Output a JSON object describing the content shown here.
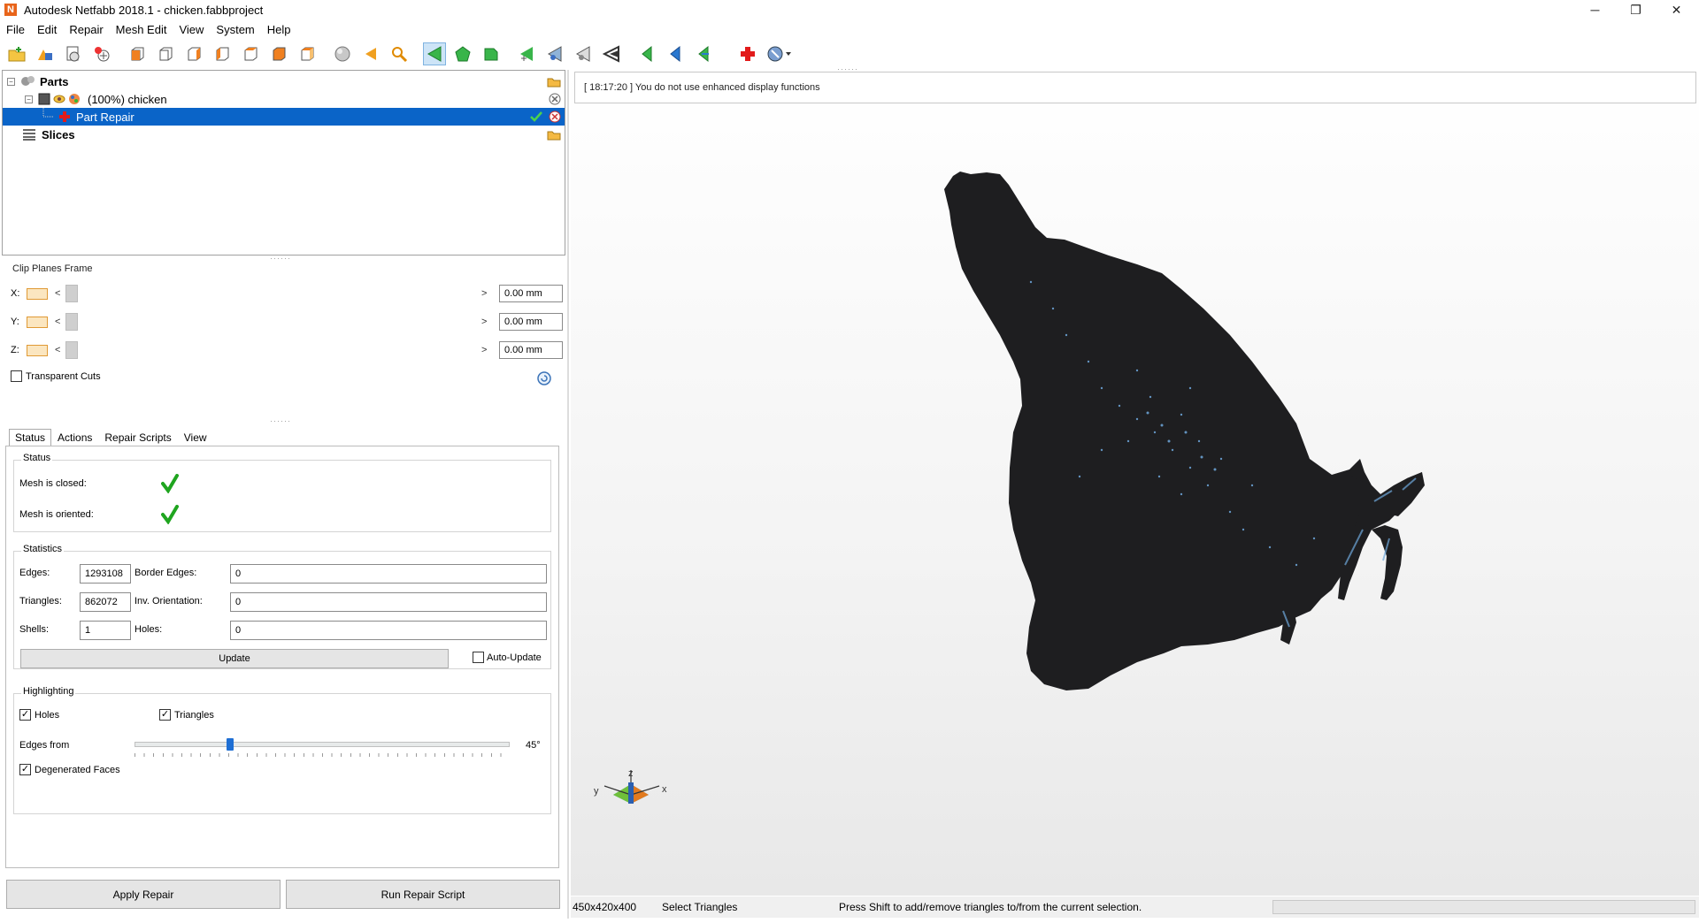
{
  "window": {
    "title": "Autodesk Netfabb 2018.1 - chicken.fabbproject",
    "app_letter": "N",
    "minimize": "─",
    "maximize": "❐",
    "close": "✕"
  },
  "menu": [
    "File",
    "Edit",
    "Repair",
    "Mesh Edit",
    "View",
    "System",
    "Help"
  ],
  "tree": {
    "parts_label": "Parts",
    "part_label": "(100%) chicken",
    "repair_label": "Part Repair",
    "slices_label": "Slices"
  },
  "clip": {
    "title": "Clip Planes Frame",
    "x_label": "X:",
    "y_label": "Y:",
    "z_label": "Z:",
    "x_value": "0.00 mm",
    "y_value": "0.00 mm",
    "z_value": "0.00 mm",
    "left_arrow": "<",
    "right_arrow": ">",
    "transparent_cuts": "Transparent Cuts"
  },
  "tabs": [
    "Status",
    "Actions",
    "Repair Scripts",
    "View"
  ],
  "status": {
    "title": "Status",
    "mesh_closed": "Mesh is closed:",
    "mesh_oriented": "Mesh is oriented:"
  },
  "statistics": {
    "title": "Statistics",
    "edges_label": "Edges:",
    "edges_value": "1293108",
    "border_edges_label": "Border Edges:",
    "border_edges_value": "0",
    "triangles_label": "Triangles:",
    "triangles_value": "862072",
    "inv_orientation_label": "Inv. Orientation:",
    "inv_orientation_value": "0",
    "shells_label": "Shells:",
    "shells_value": "1",
    "holes_label": "Holes:",
    "holes_value": "0",
    "update_button": "Update",
    "auto_update": "Auto-Update"
  },
  "highlighting": {
    "title": "Highlighting",
    "holes": "Holes",
    "triangles": "Triangles",
    "edges_from": "Edges from",
    "edges_value": "45°",
    "edges_level": 0.25,
    "degenerated": "Degenerated Faces"
  },
  "buttons": {
    "apply_repair": "Apply Repair",
    "run_repair_script": "Run Repair Script"
  },
  "viewport": {
    "message": "[ 18:17:20 ] You do not use enhanced display functions",
    "axis_z": "z",
    "axis_x": "x",
    "axis_y": "y"
  },
  "statusbar": {
    "size": "450x420x400",
    "mode": "Select Triangles",
    "hint": "Press Shift to add/remove triangles to/from the current selection."
  }
}
